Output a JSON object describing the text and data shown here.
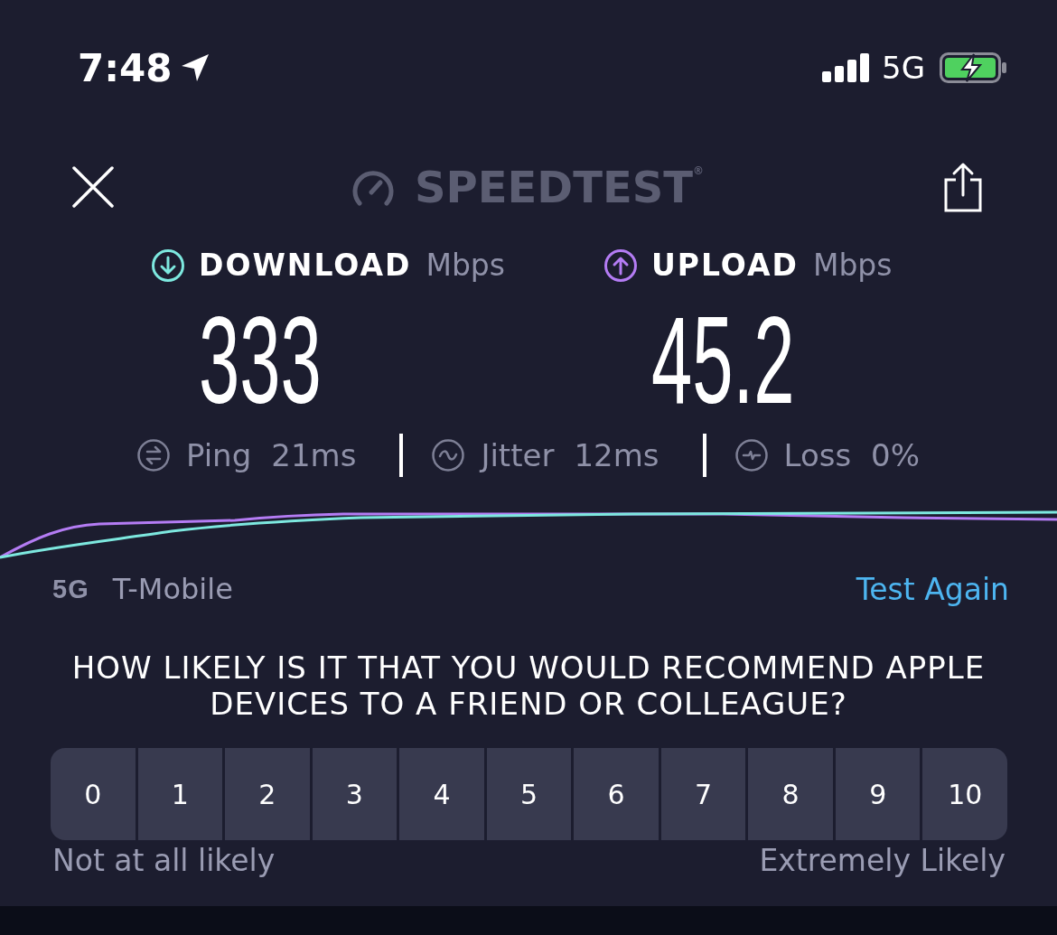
{
  "status_bar": {
    "time": "7:48",
    "network": "5G"
  },
  "header": {
    "logo": "SPEEDTEST$^{®}$"
  },
  "results": [
    {
      "kind": "download",
      "label": "DOWNLOAD",
      "unit": "Mbps",
      "value": "333"
    },
    {
      "kind": "upload",
      "label": "UPLOAD",
      "unit": "Mbps",
      "value": "45.2"
    }
  ],
  "stats": [
    {
      "kind": "ping",
      "label": "Ping",
      "value": "21ms"
    },
    {
      "kind": "jitter",
      "label": "Jitter",
      "value": "12ms"
    },
    {
      "kind": "loss",
      "label": "Loss",
      "value": "0%"
    }
  ],
  "connection": {
    "type": "5G",
    "carrier": "T-Mobile",
    "action": "Test Again"
  },
  "survey": {
    "question": "HOW LIKELY IS IT THAT YOU WOULD RECOMMEND APPLE DEVICES TO A FRIEND OR COLLEAGUE?",
    "options": [
      {
        "label": "0",
        "selected": false
      },
      {
        "label": "1",
        "selected": false
      },
      {
        "label": "2",
        "selected": false
      },
      {
        "label": "3",
        "selected": false
      },
      {
        "label": "4",
        "selected": false
      },
      {
        "label": "5",
        "selected": false
      },
      {
        "label": "6",
        "selected": false
      },
      {
        "label": "7",
        "selected": false
      },
      {
        "label": "8",
        "selected": false
      },
      {
        "label": "9",
        "selected": false
      },
      {
        "label": "10",
        "selected": false
      }
    ],
    "low_label": "Not at all likely",
    "high_label": "Extremely Likely"
  }
}
